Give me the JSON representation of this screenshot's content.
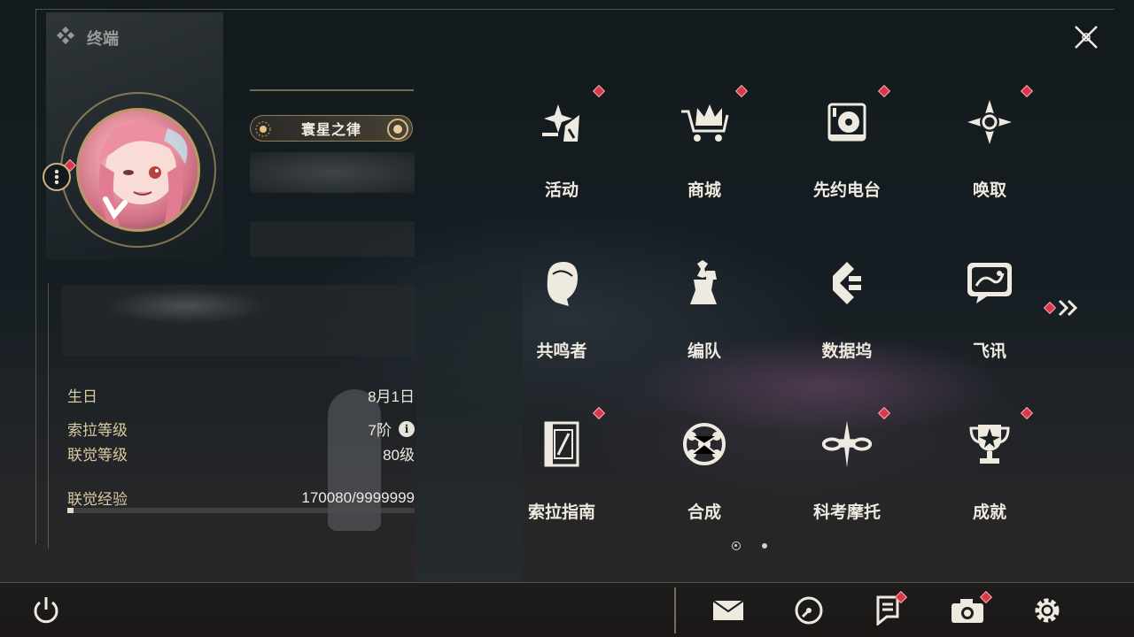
{
  "header": {
    "title": "终端"
  },
  "profile": {
    "title_badge": "寰星之律"
  },
  "stats": [
    {
      "label": "生日",
      "value": "8月1日"
    },
    {
      "label": "索拉等级",
      "value": "7阶"
    },
    {
      "label": "联觉等级",
      "value": "80级"
    },
    {
      "label": "联觉经验",
      "value": "170080/9999999"
    }
  ],
  "exp_progress": 0.017,
  "functions": [
    {
      "label": "活动",
      "icon": "activity-icon",
      "badge": true
    },
    {
      "label": "商城",
      "icon": "shop-cart-icon",
      "badge": true
    },
    {
      "label": "先约电台",
      "icon": "radio-icon",
      "badge": true
    },
    {
      "label": "唤取",
      "icon": "convene-star-icon",
      "badge": true
    },
    {
      "label": "共鸣者",
      "icon": "resonator-head-icon",
      "badge": false
    },
    {
      "label": "编队",
      "icon": "chess-team-icon",
      "badge": false
    },
    {
      "label": "数据坞",
      "icon": "data-bank-icon",
      "badge": false
    },
    {
      "label": "飞讯",
      "icon": "chat-message-icon",
      "badge": false
    },
    {
      "label": "索拉指南",
      "icon": "guide-book-icon",
      "badge": true
    },
    {
      "label": "合成",
      "icon": "synthesis-icon",
      "badge": false
    },
    {
      "label": "科考摩托",
      "icon": "motorcycle-icon",
      "badge": true
    },
    {
      "label": "成就",
      "icon": "trophy-icon",
      "badge": true
    }
  ],
  "pagination": {
    "current": 1,
    "total": 2
  },
  "colors": {
    "accent": "#c9b27e",
    "badge": "#d8394a",
    "text": "#efeadf"
  },
  "bottom_icons": [
    "power-icon",
    "mail-icon",
    "clock-icon",
    "notice-icon",
    "camera-icon",
    "settings-gear-icon"
  ]
}
